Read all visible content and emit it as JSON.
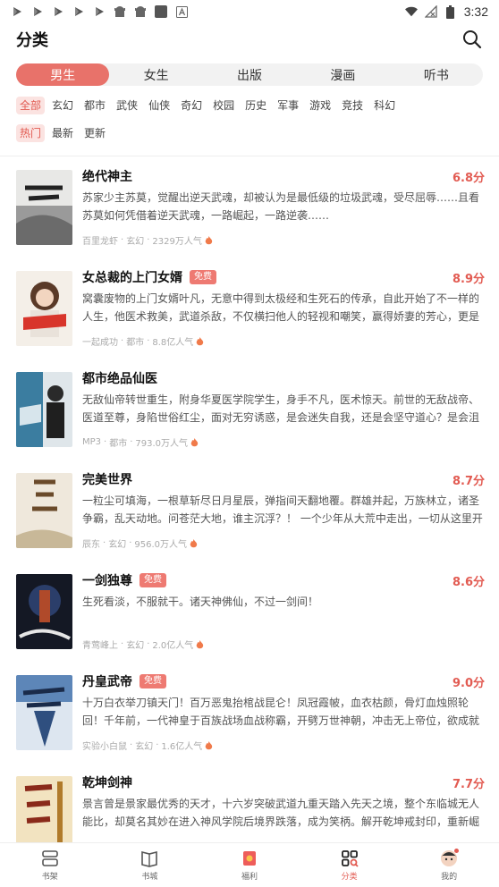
{
  "status_bar": {
    "time": "3:32"
  },
  "header": {
    "title": "分类"
  },
  "gender_tabs": [
    {
      "label": "男生",
      "active": true
    },
    {
      "label": "女生",
      "active": false
    },
    {
      "label": "出版",
      "active": false
    },
    {
      "label": "漫画",
      "active": false
    },
    {
      "label": "听书",
      "active": false
    }
  ],
  "category_filters": [
    "全部",
    "玄幻",
    "都市",
    "武侠",
    "仙侠",
    "奇幻",
    "校园",
    "历史",
    "军事",
    "游戏",
    "竞技",
    "科幻"
  ],
  "sort_filters": [
    "热门",
    "最新",
    "更新"
  ],
  "books": [
    {
      "title": "绝代神主",
      "free": false,
      "rating": "6.8分",
      "description": "苏家少主苏莫，觉醒出逆天武魂，却被认为是最低级的垃圾武魂，受尽屈辱……且看苏莫如何凭借着逆天武魂，一路崛起，一路逆袭……",
      "author": "百里龙虾",
      "category": "玄幻",
      "popularity": "2329万人气",
      "cover_color": "#8a8a8a"
    },
    {
      "title": "女总裁的上门女婿",
      "free": true,
      "free_label": "免费",
      "rating": "8.9分",
      "description": "窝囊废物的上门女婿叶凡，无意中得到太极经和生死石的传承，自此开始了不一样的人生，他医术救美，武道杀敌，不仅横扫他人的轻视和嘲笑，赢得娇妻的芳心，更是站到了这世…",
      "author": "一起成功",
      "category": "都市",
      "popularity": "8.8亿人气",
      "cover_color": "#d84a3e"
    },
    {
      "title": "都市绝品仙医",
      "free": false,
      "rating": "",
      "description": "无敌仙帝转世重生，附身华夏医学院学生，身手不凡，医术惊天。前世的无敌战帝、医道至尊，身陷世俗红尘，面对无穷诱惑，是会迷失自我，还是会坚守道心？是会沮丧颓废，彻…",
      "author": "MP3",
      "category": "都市",
      "popularity": "793.0万人气",
      "cover_color": "#2c6f8f"
    },
    {
      "title": "完美世界",
      "free": false,
      "rating": "8.7分",
      "description": "一粒尘可填海，一根草斩尽日月星辰，弹指间天翻地覆。群雄并起，万族林立，诸圣争霸，乱天动地。问苍茫大地，谁主沉浮？！ 一个少年从大荒中走出，一切从这里开始……",
      "author": "辰东",
      "category": "玄幻",
      "popularity": "956.0万人气",
      "cover_color": "#c9b89a"
    },
    {
      "title": "一剑独尊",
      "free": true,
      "free_label": "免费",
      "rating": "8.6分",
      "description": "生死看淡，不服就干。诸天神佛仙，不过一剑间！",
      "author": "青莺峰上",
      "category": "玄幻",
      "popularity": "2.0亿人气",
      "cover_color": "#1d2232"
    },
    {
      "title": "丹皇武帝",
      "free": true,
      "free_label": "免费",
      "rating": "9.0分",
      "description": "十万白衣举刀镇天门！百万恶鬼抬棺战昆仑！凤冠霞帔，血衣枯颜，骨灯血烛照轮回！千年前，一代神皇于百族战场血战称霸，开劈万世神朝，冲击无上帝位，欲成就第九帝族。然…",
      "author": "实验小白鼠",
      "category": "玄幻",
      "popularity": "1.6亿人气",
      "cover_color": "#4a6e98"
    },
    {
      "title": "乾坤剑神",
      "free": false,
      "rating": "7.7分",
      "description": "景言曾是景家最优秀的天才，十六岁突破武道九重天踏入先天之境，整个东临城无人能比，却莫名其妙在进入神风学院后境界跌落，成为笑柄。解开乾坤戒封印，重新崛起，最终制…",
      "author": "",
      "category": "",
      "popularity": "",
      "cover_color": "#b07a2a"
    }
  ],
  "bottom_nav": [
    {
      "label": "书架",
      "icon": "bookshelf-icon",
      "active": false
    },
    {
      "label": "书城",
      "icon": "book-city-icon",
      "active": false
    },
    {
      "label": "福利",
      "icon": "gift-icon",
      "active": false
    },
    {
      "label": "分类",
      "icon": "category-icon",
      "active": true
    },
    {
      "label": "我的",
      "icon": "profile-icon",
      "active": false
    }
  ],
  "colors": {
    "accent": "#e8726a",
    "rating": "#e25b52"
  }
}
